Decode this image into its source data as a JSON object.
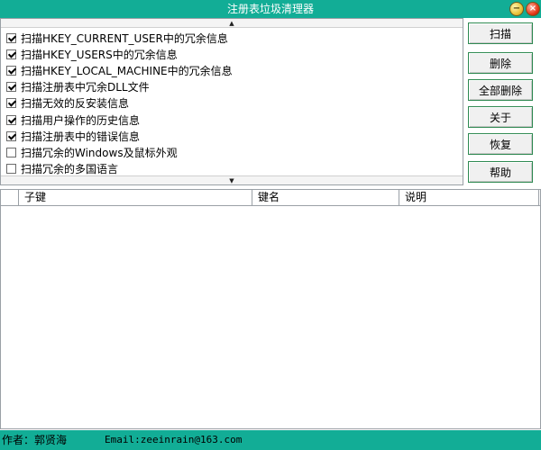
{
  "window": {
    "title": "注册表垃圾清理器",
    "minimize_glyph": "−",
    "close_glyph": "×"
  },
  "options": [
    {
      "label": "扫描HKEY_CURRENT_USER中的冗余信息",
      "checked": true
    },
    {
      "label": "扫描HKEY_USERS中的冗余信息",
      "checked": true
    },
    {
      "label": "扫描HKEY_LOCAL_MACHINE中的冗余信息",
      "checked": true
    },
    {
      "label": "扫描注册表中冗余DLL文件",
      "checked": true
    },
    {
      "label": "扫描无效的反安装信息",
      "checked": true
    },
    {
      "label": "扫描用户操作的历史信息",
      "checked": true
    },
    {
      "label": "扫描注册表中的错误信息",
      "checked": true
    },
    {
      "label": "扫描冗余的Windows及鼠标外观",
      "checked": false
    },
    {
      "label": "扫描冗余的多国语言",
      "checked": false
    }
  ],
  "scroll": {
    "up_glyph": "▲",
    "down_glyph": "▼"
  },
  "buttons": {
    "scan": "扫描",
    "delete": "删除",
    "delete_all": "全部删除",
    "about": "关于",
    "restore": "恢复",
    "help": "帮助"
  },
  "table": {
    "columns": [
      "子键",
      "键名",
      "说明"
    ],
    "rows": []
  },
  "status": {
    "author": "作者：郭贤海",
    "email": "Email:zeeinrain@163.com"
  },
  "colors": {
    "accent": "#12ad96",
    "button_border": "#2f8a52"
  }
}
